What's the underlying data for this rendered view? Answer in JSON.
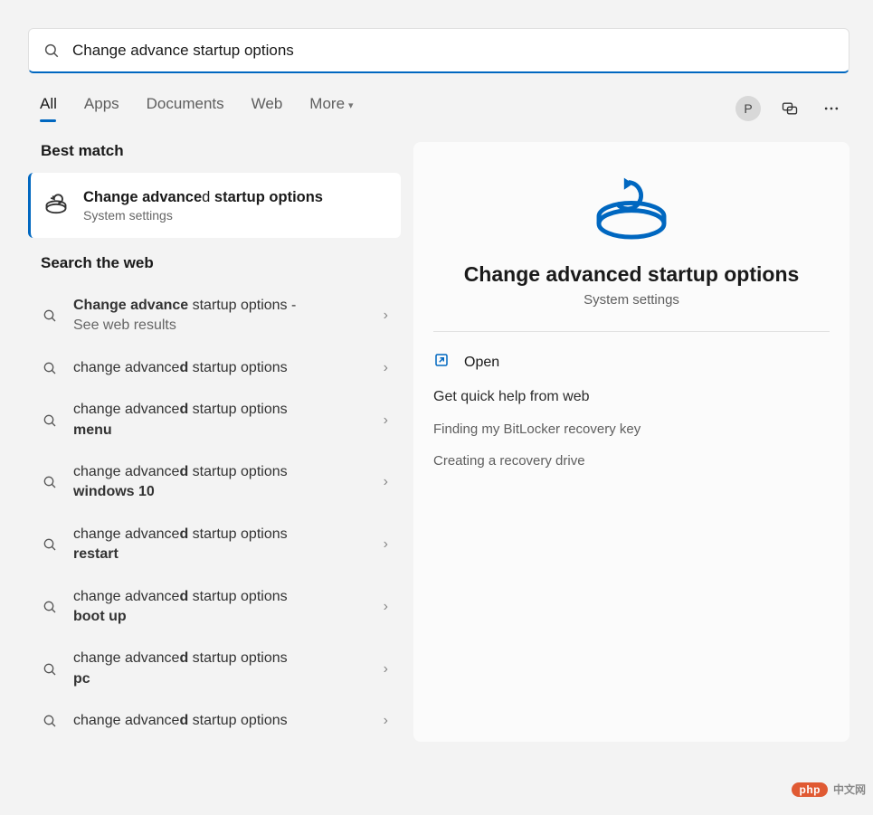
{
  "search": {
    "value": "Change advance startup options"
  },
  "filters": {
    "items": [
      {
        "label": "All",
        "active": true
      },
      {
        "label": "Apps",
        "active": false
      },
      {
        "label": "Documents",
        "active": false
      },
      {
        "label": "Web",
        "active": false
      },
      {
        "label": "More",
        "active": false,
        "dropdown": true
      }
    ]
  },
  "user": {
    "initial": "P"
  },
  "left": {
    "best_match_label": "Best match",
    "best_match": {
      "title_prefix_bold": "Change advance",
      "title_mid": "d",
      "title_suffix_bold": " startup options",
      "subtitle": "System settings"
    },
    "search_web_label": "Search the web",
    "web_results": [
      {
        "line1_bold1": "Change advance",
        "line1_plain": " startup options",
        "line1_trail": " -",
        "line2": "See web results"
      },
      {
        "line1_plain1": "change advance",
        "line1_bold1": "d",
        "line1_plain2": " startup options"
      },
      {
        "line1_plain1": "change advance",
        "line1_bold1": "d",
        "line1_plain2": " startup options",
        "line2_bold": "menu"
      },
      {
        "line1_plain1": "change advance",
        "line1_bold1": "d",
        "line1_plain2": " startup options",
        "line2_bold": "windows 10"
      },
      {
        "line1_plain1": "change advance",
        "line1_bold1": "d",
        "line1_plain2": " startup options",
        "line2_bold": "restart"
      },
      {
        "line1_plain1": "change advance",
        "line1_bold1": "d",
        "line1_plain2": " startup options",
        "line2_bold": "boot up"
      },
      {
        "line1_plain1": "change advance",
        "line1_bold1": "d",
        "line1_plain2": " startup options",
        "line2_bold": "pc"
      },
      {
        "line1_plain1": "change advance",
        "line1_bold1": "d",
        "line1_plain2": " startup options"
      }
    ]
  },
  "detail": {
    "title": "Change advanced startup options",
    "subtitle": "System settings",
    "open_label": "Open",
    "help_label": "Get quick help from web",
    "help_links": [
      "Finding my BitLocker recovery key",
      "Creating a recovery drive"
    ]
  },
  "watermark": {
    "brand": "php",
    "text": "中文网"
  }
}
